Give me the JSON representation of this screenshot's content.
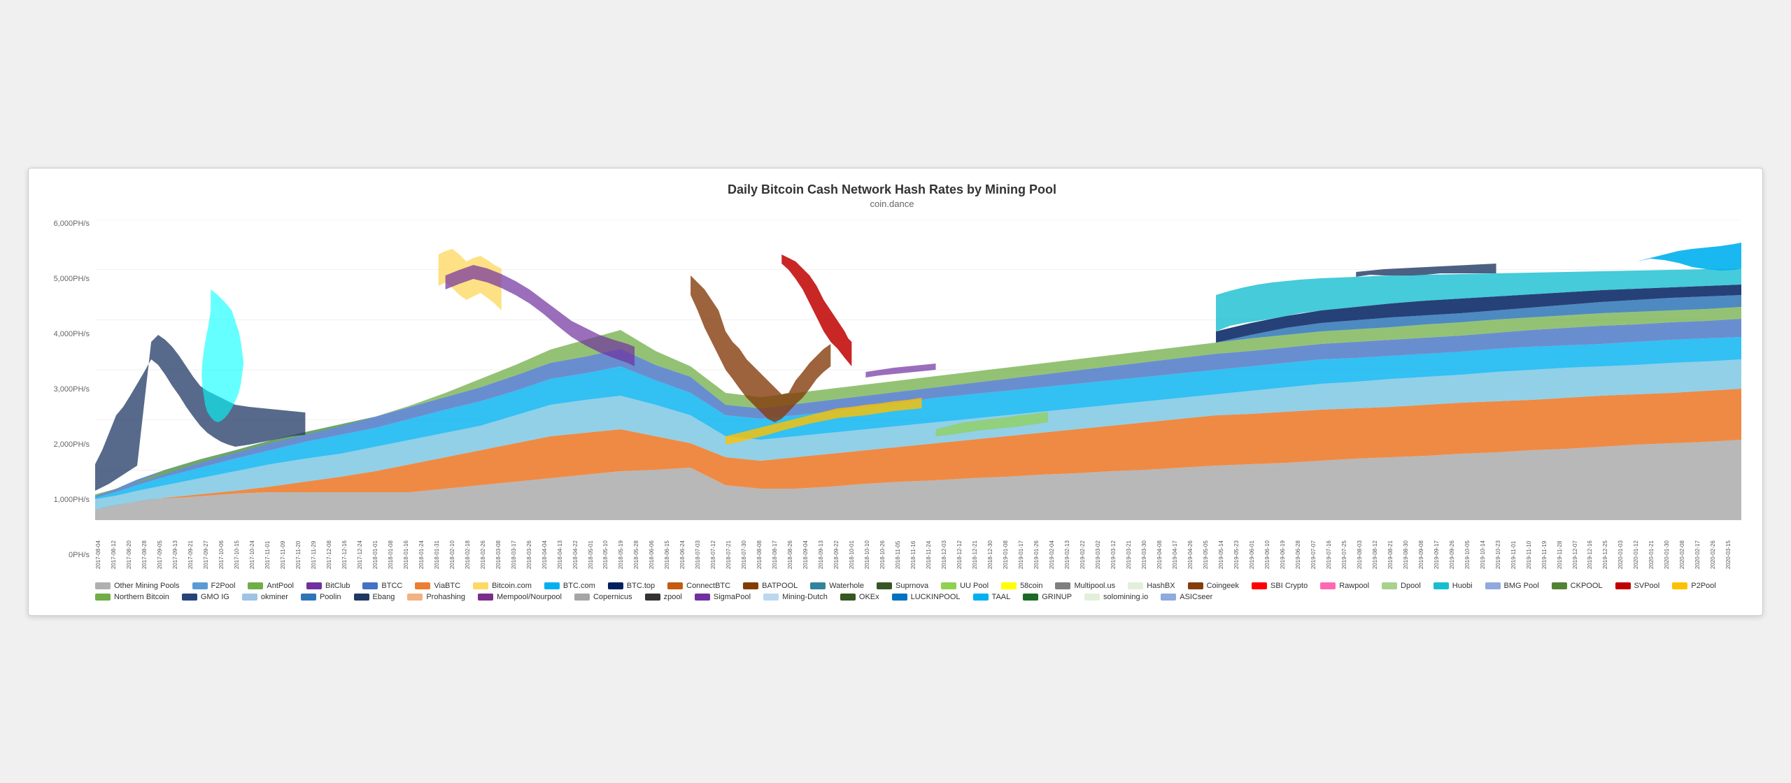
{
  "title": "Daily Bitcoin Cash Network Hash Rates by Mining Pool",
  "subtitle": "coin.dance",
  "yAxis": {
    "labels": [
      "6,000PH/s",
      "5,000PH/s",
      "4,000PH/s",
      "3,000PH/s",
      "2,000PH/s",
      "1,000PH/s",
      "0PH/s"
    ]
  },
  "legend": [
    {
      "label": "Other Mining Pools",
      "color": "#b0b0b0"
    },
    {
      "label": "F2Pool",
      "color": "#5b9bd5"
    },
    {
      "label": "AntPool",
      "color": "#70ad47"
    },
    {
      "label": "BitClub",
      "color": "#7030a0"
    },
    {
      "label": "BTCC",
      "color": "#4472c4"
    },
    {
      "label": "ViaBTC",
      "color": "#ed7d31"
    },
    {
      "label": "Bitcoin.com",
      "color": "#ffd966"
    },
    {
      "label": "BTC.com",
      "color": "#00b0f0"
    },
    {
      "label": "BTC.top",
      "color": "#002060"
    },
    {
      "label": "ConnectBTC",
      "color": "#c55a11"
    },
    {
      "label": "BATPOOL",
      "color": "#833c00"
    },
    {
      "label": "Waterhole",
      "color": "#31849b"
    },
    {
      "label": "Suprnova",
      "color": "#375623"
    },
    {
      "label": "UU Pool",
      "color": "#92d050"
    },
    {
      "label": "58coin",
      "color": "#ffff00"
    },
    {
      "label": "Multipool.us",
      "color": "#7f7f7f"
    },
    {
      "label": "HashBX",
      "color": "#e2efda"
    },
    {
      "label": "Coingeek",
      "color": "#843c0c"
    },
    {
      "label": "SBI Crypto",
      "color": "#ff0000"
    },
    {
      "label": "Rawpool",
      "color": "#ff69b4"
    },
    {
      "label": "Dpool",
      "color": "#a9d18e"
    },
    {
      "label": "Huobi",
      "color": "#17becf"
    },
    {
      "label": "BMG Pool",
      "color": "#8faadc"
    },
    {
      "label": "CKPOOL",
      "color": "#548235"
    },
    {
      "label": "SVPool",
      "color": "#c00000"
    },
    {
      "label": "P2Pool",
      "color": "#ffc000"
    },
    {
      "label": "Northern Bitcoin",
      "color": "#70ad47"
    },
    {
      "label": "GMO IG",
      "color": "#264478"
    },
    {
      "label": "okminer",
      "color": "#9dc3e6"
    },
    {
      "label": "Poolin",
      "color": "#2e75b6"
    },
    {
      "label": "Ebang",
      "color": "#1f3864"
    },
    {
      "label": "Prohashing",
      "color": "#f4b183"
    },
    {
      "label": "Mempool/Nourpool",
      "color": "#7b2d8b"
    },
    {
      "label": "Copernicus",
      "color": "#a5a5a5"
    },
    {
      "label": "zpool",
      "color": "#333333"
    },
    {
      "label": "SigmaPool",
      "color": "#7030a0"
    },
    {
      "label": "Mining-Dutch",
      "color": "#bdd7ee"
    },
    {
      "label": "OKEx",
      "color": "#375623"
    },
    {
      "label": "LUCKINPOOL",
      "color": "#0070c0"
    },
    {
      "label": "TAAL",
      "color": "#00b0f0"
    },
    {
      "label": "GRINUP",
      "color": "#196b24"
    },
    {
      "label": "solomining.io",
      "color": "#e2efda"
    },
    {
      "label": "ASICseer",
      "color": "#8faadc"
    }
  ]
}
